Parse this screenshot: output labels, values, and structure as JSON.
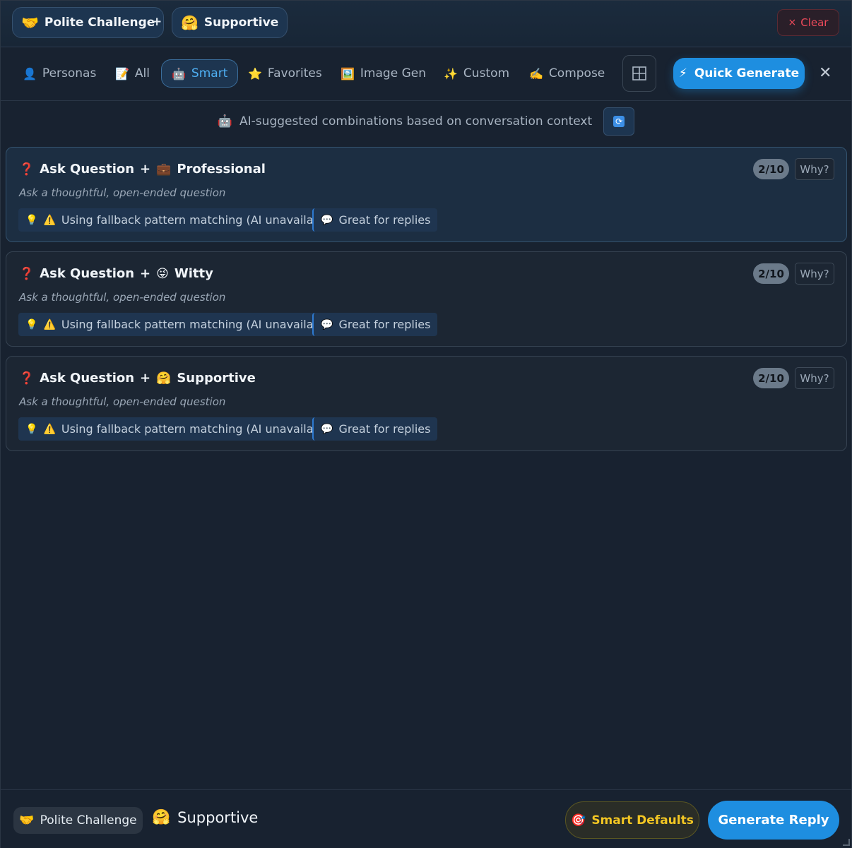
{
  "header": {
    "selected": [
      {
        "emoji": "🤝",
        "label": "Polite Challenge",
        "icon": "handshake-icon"
      },
      {
        "emoji": "🤗",
        "label": "Supportive",
        "icon": "hug-icon"
      }
    ],
    "plus": "+",
    "clear_label": "Clear",
    "clear_icon": "×"
  },
  "tabs": [
    {
      "emoji": "👤",
      "label": "Personas",
      "icon": "person-icon"
    },
    {
      "emoji": "📝",
      "label": "All",
      "icon": "memo-icon"
    },
    {
      "emoji": "🤖",
      "label": "Smart",
      "icon": "robot-icon",
      "active": true
    },
    {
      "emoji": "⭐",
      "label": "Favorites",
      "icon": "star-icon"
    },
    {
      "emoji": "🖼️",
      "label": "Image Gen",
      "icon": "picture-icon"
    },
    {
      "emoji": "✨",
      "label": "Custom",
      "icon": "sparkles-icon"
    },
    {
      "emoji": "✍️",
      "label": "Compose",
      "icon": "writing-hand-icon"
    }
  ],
  "quick_generate": {
    "emoji": "⚡",
    "label": "Quick Generate"
  },
  "close_icon": "✕",
  "info": {
    "emoji": "🤖",
    "text": "AI-suggested combinations based on conversation context",
    "refresh_icon": "🔄"
  },
  "cards": [
    {
      "left_emoji": "❓",
      "left_label": "Ask Question",
      "plus": "+",
      "right_emoji": "💼",
      "right_label": "Professional",
      "description": "Ask a thoughtful, open-ended question",
      "tag1_emoji_a": "💡",
      "tag1_emoji_b": "⚠️",
      "tag1_text": "Using fallback pattern matching (AI unavailable)",
      "tag2_emoji": "💬",
      "tag2_text": "Great for replies",
      "score": "2/10",
      "why_label": "Why?"
    },
    {
      "left_emoji": "❓",
      "left_label": "Ask Question",
      "plus": "+",
      "right_emoji": "😜",
      "right_label": "Witty",
      "description": "Ask a thoughtful, open-ended question",
      "tag1_emoji_a": "💡",
      "tag1_emoji_b": "⚠️",
      "tag1_text": "Using fallback pattern matching (AI unavailable)",
      "tag2_emoji": "💬",
      "tag2_text": "Great for replies",
      "score": "2/10",
      "why_label": "Why?"
    },
    {
      "left_emoji": "❓",
      "left_label": "Ask Question",
      "plus": "+",
      "right_emoji": "🤗",
      "right_label": "Supportive",
      "description": "Ask a thoughtful, open-ended question",
      "tag1_emoji_a": "💡",
      "tag1_emoji_b": "⚠️",
      "tag1_text": "Using fallback pattern matching (AI unavailable)",
      "tag2_emoji": "💬",
      "tag2_text": "Great for replies",
      "score": "2/10",
      "why_label": "Why?"
    }
  ],
  "footer": {
    "chip_emoji": "🤝",
    "chip_label": "Polite Challenge",
    "plain_emoji": "🤗",
    "plain_label": "Supportive",
    "smart_defaults_emoji": "🎯",
    "smart_defaults_label": "Smart Defaults",
    "generate_label": "Generate Reply"
  },
  "colors": {
    "accent": "#1e8ee0",
    "danger": "#ef4a5b",
    "warning": "#f3c623",
    "background": "#182230"
  }
}
